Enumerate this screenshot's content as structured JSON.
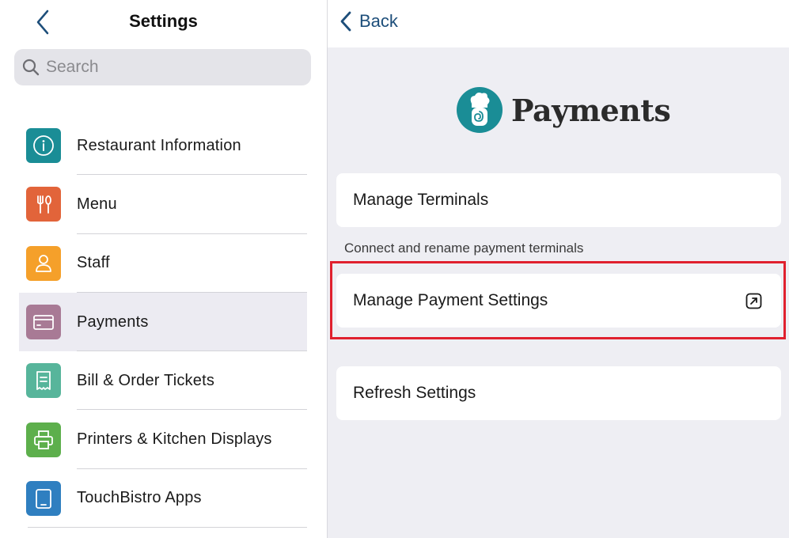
{
  "left_pane": {
    "title": "Settings",
    "search_placeholder": "Search",
    "items": [
      {
        "label": "Restaurant Information",
        "icon": "info-icon",
        "color": "#1a8d96"
      },
      {
        "label": "Menu",
        "icon": "fork-knife-icon",
        "color": "#e2643a"
      },
      {
        "label": "Staff",
        "icon": "person-icon",
        "color": "#f5a02a"
      },
      {
        "label": "Payments",
        "icon": "card-icon",
        "color": "#a87a95",
        "selected": true
      },
      {
        "label": "Bill & Order Tickets",
        "icon": "receipt-icon",
        "color": "#57b59b"
      },
      {
        "label": "Printers & Kitchen Displays",
        "icon": "printer-icon",
        "color": "#5daf4c"
      },
      {
        "label": "TouchBistro Apps",
        "icon": "tablet-icon",
        "color": "#2f7fc0"
      }
    ]
  },
  "right_pane": {
    "back_label": "Back",
    "brand_title": "Payments",
    "brand_logo": "chef-swirl-logo",
    "cards": {
      "manage_terminals": "Manage Terminals",
      "terminals_hint": "Connect and rename payment terminals",
      "manage_payment_settings": "Manage Payment Settings",
      "refresh_settings": "Refresh Settings"
    }
  },
  "colors": {
    "accent_blue": "#1d4e7a",
    "highlight_red": "#e0202e",
    "brand_teal": "#1a8d96"
  }
}
